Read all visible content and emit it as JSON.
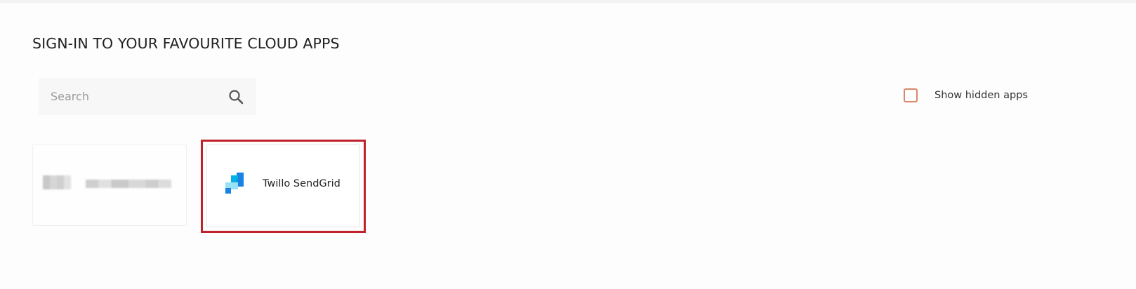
{
  "page": {
    "title": "SIGN-IN TO YOUR FAVOURITE CLOUD APPS"
  },
  "search": {
    "placeholder": "Search",
    "value": "",
    "icon": "search-icon"
  },
  "filters": {
    "show_hidden_label": "Show hidden apps",
    "show_hidden_checked": false,
    "checkbox_color": "#d9866b"
  },
  "apps": [
    {
      "name": "",
      "redacted": true
    },
    {
      "name": "Twillo SendGrid",
      "icon": "sendgrid-logo",
      "highlighted": true
    }
  ],
  "colors": {
    "highlight": "#c0222b",
    "sendgrid_blue": "#1a82e2",
    "sendgrid_light": "#99e1f4"
  }
}
